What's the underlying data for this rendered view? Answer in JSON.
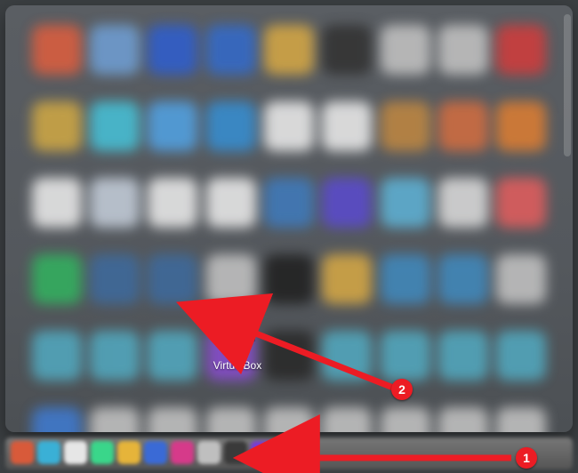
{
  "app": {
    "virtualbox_label": "VirtualBox"
  },
  "annotations": {
    "step1": "1",
    "step2": "2"
  },
  "grid_tiles": [
    "#e25b3a",
    "#6a9dd6",
    "#2b5ed6",
    "#2f6ad1",
    "#d6a53a",
    "#333333",
    "#bfbfbf",
    "#bfbfbf",
    "#d83a3a",
    "#cfa53a",
    "#3cc0d8",
    "#4aa0e6",
    "#2f8dd6",
    "#e6e6e6",
    "#e6e6e6",
    "#c0843a",
    "#d66a3a",
    "#e07a2a",
    "#e6e6e6",
    "#bfc9d6",
    "#e6e6e6",
    "#e6e6e6",
    "#3a7ac0",
    "#5a4ad6",
    "#56b0d6",
    "#d6d6d6",
    "#e85a5a",
    "#29b25a",
    "#3a6aa0",
    "#3a6aa0",
    "#bfbfbf",
    "#222222",
    "#d6a53a",
    "#3a88c0",
    "#3a88c0",
    "#bfbfbf",
    "#4aa8c0",
    "#4aa8c0",
    "#4aa8c0",
    "#8a4ad6",
    "#2a2a2a",
    "#4aa8c0",
    "#4aa8c0",
    "#4aa8c0",
    "#4aa8c0",
    "#3a7ad6",
    "#bfbfbf",
    "#bfbfbf",
    "#bfbfbf",
    "#bfbfbf",
    "#bfbfbf",
    "#bfbfbf",
    "#bfbfbf",
    "#bfbfbf"
  ],
  "dock_tiles": [
    "#d85a3a",
    "#3ab0d6",
    "#e6e6e6",
    "#3ad68a",
    "#e6b43a",
    "#3a6ad6",
    "#d63a8a",
    "#bfbfbf",
    "#3a3a3a",
    "#7a3ad6",
    "#bfbfbf"
  ]
}
